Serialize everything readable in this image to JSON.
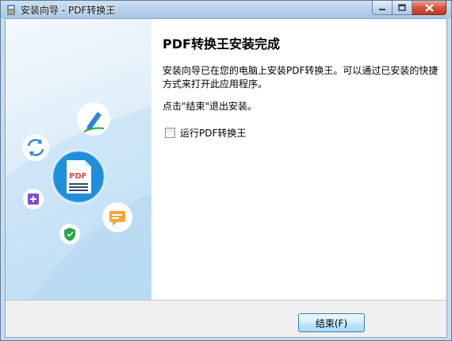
{
  "window": {
    "title": "安装向导 - PDF转换王",
    "icons": [
      "installer-app-icon",
      "minimize-icon",
      "maximize-icon",
      "close-icon"
    ]
  },
  "sidebar": {
    "badge_text": "PDF",
    "icons": [
      "sync-icon",
      "pen-edit-icon",
      "pdf-document-icon",
      "plus-icon",
      "message-icon",
      "shield-icon"
    ]
  },
  "content": {
    "title": "PDF转换王安装完成",
    "description": "安装向导已在您的电脑上安装PDF转换王。可以通过已安装的快捷方式来打开此应用程序。",
    "hint": "点击\"结束\"退出安装。",
    "run_checkbox": {
      "label": "运行PDF转换王",
      "checked": false
    }
  },
  "footer": {
    "finish_label": "结束(F)"
  },
  "colors": {
    "accent": "#1e8fd8",
    "sidebar_bg": "#cde5f6",
    "titlebar": "#b9d1ea",
    "footer_bg": "#f0f0f0"
  }
}
